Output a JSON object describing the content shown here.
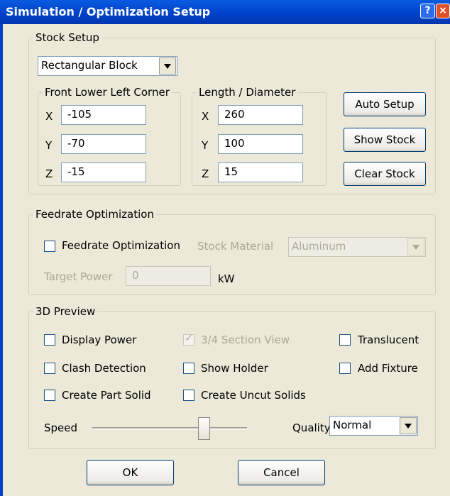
{
  "window": {
    "title": "Simulation / Optimization Setup",
    "help_glyph": "?",
    "close_glyph": "×"
  },
  "stock_setup": {
    "legend": "Stock Setup",
    "stock_type": "Rectangular Block",
    "corner": {
      "legend": "Front Lower Left Corner",
      "x_label": "X",
      "x_value": "-105",
      "y_label": "Y",
      "y_value": "-70",
      "z_label": "Z",
      "z_value": "-15"
    },
    "length": {
      "legend": "Length / Diameter",
      "x_label": "X",
      "x_value": "260",
      "y_label": "Y",
      "y_value": "100",
      "z_label": "Z",
      "z_value": "15"
    },
    "auto_setup": "Auto Setup",
    "show_stock": "Show Stock",
    "clear_stock": "Clear Stock"
  },
  "feedrate": {
    "legend": "Feedrate Optimization",
    "checkbox_label": "Feedrate Optimization",
    "material_label": "Stock Material",
    "material_value": "Aluminum",
    "target_power_label": "Target Power",
    "target_power_value": "0",
    "unit": "kW"
  },
  "preview": {
    "legend": "3D Preview",
    "display_power": "Display Power",
    "section_view": "3/4 Section View",
    "translucent": "Translucent",
    "clash_detection": "Clash Detection",
    "show_holder": "Show Holder",
    "add_fixture": "Add Fixture",
    "create_part_solid": "Create Part Solid",
    "create_uncut_solids": "Create Uncut Solids",
    "speed_label": "Speed",
    "speed_level": 0.72,
    "quality_label": "Quality",
    "quality_value": "Normal"
  },
  "buttons": {
    "ok": "OK",
    "cancel": "Cancel"
  },
  "colors": {
    "titlebar": "#0040C8",
    "dialog_bg": "#ECE9D8",
    "close_button": "#E0502A"
  }
}
